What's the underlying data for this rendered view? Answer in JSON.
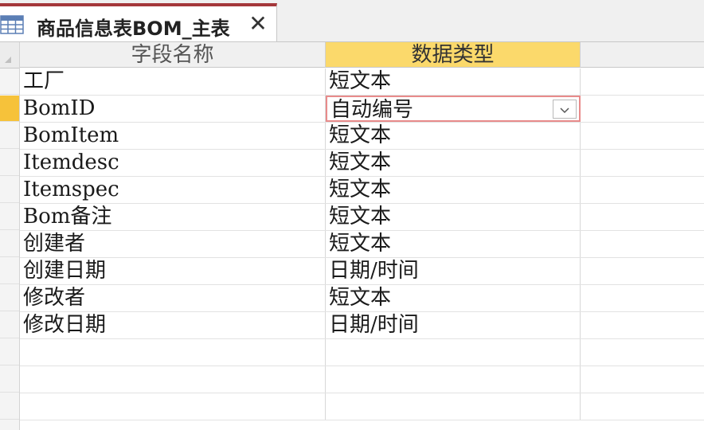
{
  "tab": {
    "title": "商品信息表BOM_主表",
    "close_symbol": "✕",
    "icon": "table-icon",
    "accent_color": "#a4373a"
  },
  "grid": {
    "headers": [
      "字段名称",
      "数据类型"
    ],
    "active_header_color": "#fbd96b",
    "row_marker_color": "#f6c23a",
    "rows": [
      {
        "field": "工厂",
        "type": "短文本"
      },
      {
        "field": "BomID",
        "type": "自动编号"
      },
      {
        "field": "BomItem",
        "type": "短文本"
      },
      {
        "field": "Itemdesc",
        "type": "短文本"
      },
      {
        "field": "Itemspec",
        "type": "短文本"
      },
      {
        "field": "Bom备注",
        "type": "短文本"
      },
      {
        "field": "创建者",
        "type": "短文本"
      },
      {
        "field": "创建日期",
        "type": "日期/时间"
      },
      {
        "field": "修改者",
        "type": "短文本"
      },
      {
        "field": "修改日期",
        "type": "日期/时间"
      }
    ],
    "active_row_index": 1,
    "dropdown_icon": "chevron-down-icon"
  }
}
